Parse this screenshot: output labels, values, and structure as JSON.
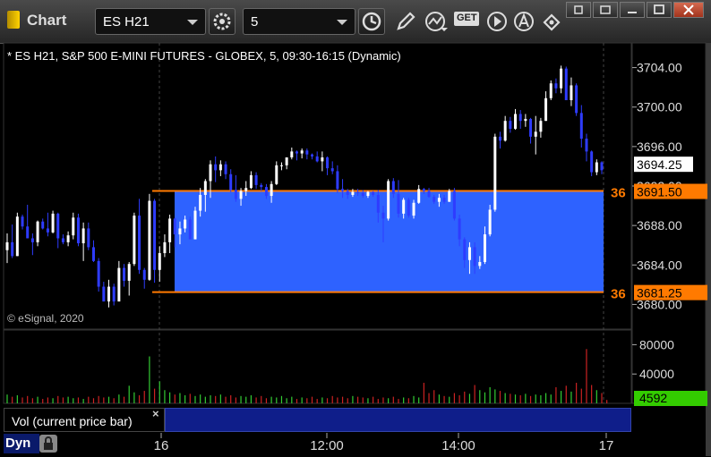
{
  "window": {
    "title": "Chart",
    "symbol_value": "ES H21",
    "interval_value": "5",
    "get_label": "GET"
  },
  "chart_header": "* ES H21, S&P 500 E-MINI FUTURES - GLOBEX, 5, 09:30-16:15 (Dynamic)",
  "copyright": "© eSignal, 2020",
  "volume_pane": {
    "label": "Vol (current price bar)",
    "close_symbol": "×"
  },
  "bottom": {
    "dyn_label": "Dyn"
  },
  "colors": {
    "up": "#ffffff",
    "down": "#2e3cff",
    "zone": "#2e62ff",
    "zone_line": "#ff7a00",
    "vol_up": "#33cc33",
    "vol_down": "#cc2222",
    "vol_badge": "#33cc00"
  },
  "chart_data": {
    "type": "candlestick",
    "title": "* ES H21, S&P 500 E-MINI FUTURES - GLOBEX, 5, 09:30-16:15 (Dynamic)",
    "x_ticks": [
      "16",
      "12:00",
      "14:00",
      "17"
    ],
    "y_ticks": [
      "3704.00",
      "3700.00",
      "3696.00",
      "3692.00",
      "3688.00",
      "3684.00",
      "3680.00"
    ],
    "ylim": [
      3677.5,
      3706.5
    ],
    "last_price": "3694.25",
    "last_price_value": 3694.25,
    "zone": {
      "top": 3691.5,
      "bottom": 3681.25,
      "top_label": "3691.50",
      "bottom_label": "3681.25",
      "left_tag": "36"
    },
    "candles": [
      [
        3685.5,
        3687.2,
        3684.2,
        3686.3
      ],
      [
        3686.3,
        3688.1,
        3684.7,
        3684.9
      ],
      [
        3684.9,
        3689.3,
        3684.9,
        3688.9
      ],
      [
        3688.9,
        3689.1,
        3687.6,
        3687.9
      ],
      [
        3687.9,
        3690.1,
        3686.7,
        3686.7
      ],
      [
        3686.7,
        3687.2,
        3685.0,
        3686.3
      ],
      [
        3686.3,
        3688.5,
        3685.9,
        3688.4
      ],
      [
        3688.4,
        3688.7,
        3687.6,
        3687.7
      ],
      [
        3687.7,
        3689.3,
        3686.9,
        3687.3
      ],
      [
        3687.3,
        3689.5,
        3687.2,
        3689.2
      ],
      [
        3689.2,
        3689.3,
        3685.7,
        3686.7
      ],
      [
        3686.7,
        3687.1,
        3686.1,
        3686.3
      ],
      [
        3686.3,
        3687.4,
        3685.9,
        3687.0
      ],
      [
        3687.0,
        3689.3,
        3686.6,
        3688.8
      ],
      [
        3688.8,
        3689.2,
        3685.9,
        3686.2
      ],
      [
        3686.2,
        3688.3,
        3684.4,
        3687.7
      ],
      [
        3687.7,
        3688.3,
        3685.5,
        3685.8
      ],
      [
        3685.8,
        3686.5,
        3684.3,
        3684.4
      ],
      [
        3684.4,
        3684.7,
        3681.3,
        3681.8
      ],
      [
        3681.8,
        3682.3,
        3680.3,
        3680.3
      ],
      [
        3680.3,
        3682.5,
        3679.7,
        3681.8
      ],
      [
        3681.8,
        3682.1,
        3679.9,
        3680.3
      ],
      [
        3680.3,
        3684.4,
        3680.3,
        3683.7
      ],
      [
        3683.7,
        3684.1,
        3681.8,
        3682.4
      ],
      [
        3682.4,
        3684.3,
        3680.9,
        3684.1
      ],
      [
        3684.1,
        3689.3,
        3683.9,
        3689.0
      ],
      [
        3689.0,
        3690.7,
        3683.1,
        3683.5
      ],
      [
        3683.5,
        3683.7,
        3681.6,
        3682.5
      ],
      [
        3682.5,
        3691.2,
        3682.4,
        3690.5
      ],
      [
        3690.5,
        3690.7,
        3682.2,
        3683.5
      ],
      [
        3683.5,
        3685.9,
        3682.3,
        3685.2
      ],
      [
        3685.2,
        3687.1,
        3684.8,
        3686.3
      ],
      [
        3686.3,
        3689.1,
        3685.2,
        3688.7
      ],
      [
        3688.7,
        3688.8,
        3685.8,
        3687.1
      ],
      [
        3687.1,
        3688.4,
        3686.1,
        3687.7
      ],
      [
        3687.7,
        3689.0,
        3687.3,
        3688.6
      ],
      [
        3688.6,
        3688.9,
        3686.6,
        3686.6
      ],
      [
        3686.6,
        3689.9,
        3686.6,
        3689.5
      ],
      [
        3689.5,
        3691.8,
        3688.9,
        3691.1
      ],
      [
        3691.1,
        3692.7,
        3689.4,
        3692.5
      ],
      [
        3692.5,
        3694.6,
        3690.8,
        3694.2
      ],
      [
        3694.2,
        3695.0,
        3692.4,
        3693.6
      ],
      [
        3693.6,
        3694.6,
        3693.0,
        3694.2
      ],
      [
        3694.2,
        3694.5,
        3692.7,
        3693.2
      ],
      [
        3693.2,
        3693.7,
        3691.4,
        3691.6
      ],
      [
        3691.6,
        3693.1,
        3690.4,
        3690.7
      ],
      [
        3690.7,
        3691.8,
        3690.0,
        3691.5
      ],
      [
        3691.5,
        3692.5,
        3691.0,
        3691.8
      ],
      [
        3691.8,
        3693.5,
        3691.7,
        3693.1
      ],
      [
        3693.1,
        3693.4,
        3691.7,
        3692.1
      ],
      [
        3692.1,
        3692.3,
        3691.5,
        3691.9
      ],
      [
        3691.9,
        3692.2,
        3690.7,
        3691.0
      ],
      [
        3691.0,
        3692.5,
        3690.3,
        3692.2
      ],
      [
        3692.2,
        3694.5,
        3692.1,
        3694.1
      ],
      [
        3694.1,
        3694.4,
        3693.6,
        3694.1
      ],
      [
        3694.1,
        3694.9,
        3693.7,
        3694.9
      ],
      [
        3694.9,
        3695.9,
        3694.7,
        3695.5
      ],
      [
        3695.5,
        3695.6,
        3694.6,
        3695.3
      ],
      [
        3695.3,
        3695.8,
        3694.8,
        3695.6
      ],
      [
        3695.6,
        3695.8,
        3694.7,
        3695.2
      ],
      [
        3695.2,
        3695.3,
        3694.7,
        3695.0
      ],
      [
        3695.0,
        3695.5,
        3694.4,
        3694.5
      ],
      [
        3694.5,
        3695.5,
        3693.5,
        3694.9
      ],
      [
        3694.9,
        3695.0,
        3693.1,
        3693.8
      ],
      [
        3693.8,
        3694.5,
        3693.2,
        3693.5
      ],
      [
        3693.5,
        3694.1,
        3691.3,
        3691.7
      ],
      [
        3691.7,
        3692.7,
        3690.8,
        3691.5
      ],
      [
        3691.5,
        3691.7,
        3690.7,
        3691.1
      ],
      [
        3691.1,
        3691.7,
        3690.9,
        3691.4
      ],
      [
        3691.4,
        3691.7,
        3691.0,
        3691.3
      ],
      [
        3691.3,
        3691.6,
        3690.8,
        3691.0
      ],
      [
        3691.0,
        3691.5,
        3690.8,
        3691.4
      ],
      [
        3691.4,
        3691.5,
        3690.9,
        3691.1
      ],
      [
        3691.1,
        3691.6,
        3688.3,
        3689.3
      ],
      [
        3689.3,
        3690.0,
        3686.3,
        3688.7
      ],
      [
        3688.7,
        3692.7,
        3688.5,
        3692.5
      ],
      [
        3692.5,
        3692.8,
        3690.8,
        3691.2
      ],
      [
        3691.2,
        3692.6,
        3688.8,
        3689.2
      ],
      [
        3689.2,
        3690.8,
        3688.7,
        3690.6
      ],
      [
        3690.6,
        3690.8,
        3688.8,
        3689.0
      ],
      [
        3689.0,
        3690.6,
        3688.7,
        3690.3
      ],
      [
        3690.3,
        3692.1,
        3690.2,
        3691.7
      ],
      [
        3691.7,
        3691.8,
        3691.2,
        3691.5
      ],
      [
        3691.5,
        3691.8,
        3690.8,
        3690.9
      ],
      [
        3690.9,
        3691.1,
        3690.2,
        3690.4
      ],
      [
        3690.4,
        3691.2,
        3689.9,
        3690.8
      ],
      [
        3690.8,
        3691.1,
        3690.2,
        3690.4
      ],
      [
        3690.4,
        3691.7,
        3690.4,
        3691.5
      ],
      [
        3691.5,
        3691.8,
        3688.5,
        3688.7
      ],
      [
        3688.7,
        3689.1,
        3685.9,
        3686.6
      ],
      [
        3686.6,
        3686.8,
        3683.7,
        3684.5
      ],
      [
        3684.5,
        3686.3,
        3683.1,
        3685.8
      ],
      [
        3685.8,
        3686.3,
        3683.1,
        3683.9
      ],
      [
        3683.9,
        3684.9,
        3683.6,
        3684.3
      ],
      [
        3684.3,
        3687.9,
        3684.1,
        3687.1
      ],
      [
        3687.1,
        3690.1,
        3686.9,
        3689.6
      ],
      [
        3689.6,
        3697.3,
        3689.4,
        3697.0
      ],
      [
        3697.0,
        3697.5,
        3695.8,
        3696.6
      ],
      [
        3696.6,
        3699.1,
        3696.5,
        3698.6
      ],
      [
        3698.6,
        3699.0,
        3697.4,
        3697.8
      ],
      [
        3697.8,
        3699.8,
        3697.7,
        3699.3
      ],
      [
        3699.3,
        3699.7,
        3697.8,
        3698.6
      ],
      [
        3698.6,
        3699.3,
        3698.0,
        3698.8
      ],
      [
        3698.8,
        3698.9,
        3696.3,
        3697.0
      ],
      [
        3697.0,
        3699.1,
        3695.2,
        3697.5
      ],
      [
        3697.5,
        3698.9,
        3696.9,
        3698.6
      ],
      [
        3698.6,
        3701.6,
        3698.6,
        3700.9
      ],
      [
        3700.9,
        3702.7,
        3700.7,
        3702.4
      ],
      [
        3702.4,
        3702.9,
        3701.4,
        3701.9
      ],
      [
        3701.9,
        3704.2,
        3701.4,
        3703.9
      ],
      [
        3703.9,
        3704.1,
        3700.7,
        3700.7
      ],
      [
        3700.7,
        3703.0,
        3700.1,
        3702.2
      ],
      [
        3702.2,
        3702.4,
        3699.1,
        3699.4
      ],
      [
        3699.4,
        3700.2,
        3695.9,
        3696.8
      ],
      [
        3696.8,
        3697.3,
        3694.5,
        3695.5
      ],
      [
        3695.5,
        3695.6,
        3693.0,
        3693.4
      ],
      [
        3693.4,
        3694.7,
        3693.1,
        3694.4
      ],
      [
        3694.4,
        3694.5,
        3693.2,
        3693.6
      ]
    ],
    "volume": {
      "ylim": [
        0,
        100000
      ],
      "y_ticks": [
        "80000",
        "40000"
      ],
      "last_label": "4592",
      "values": [
        12000,
        9000,
        11000,
        8000,
        10000,
        7000,
        9000,
        6000,
        8000,
        7000,
        10000,
        8000,
        9000,
        7000,
        8000,
        6000,
        9000,
        7000,
        10000,
        8000,
        9000,
        7000,
        12000,
        9000,
        24000,
        15000,
        11000,
        17000,
        64000,
        20000,
        30000,
        18000,
        15000,
        12000,
        14000,
        11000,
        13000,
        10000,
        12000,
        9000,
        11000,
        10000,
        12000,
        9000,
        11000,
        8000,
        10000,
        9000,
        11000,
        8000,
        10000,
        7000,
        9000,
        8000,
        10000,
        7000,
        9000,
        6000,
        8000,
        7000,
        9000,
        6000,
        8000,
        7000,
        10000,
        8000,
        9000,
        7000,
        10000,
        9000,
        8000,
        7000,
        9000,
        6000,
        8000,
        7000,
        9000,
        6000,
        8000,
        7000,
        10000,
        8000,
        28000,
        14000,
        18000,
        12000,
        10000,
        9000,
        14000,
        11000,
        16000,
        13000,
        25000,
        18000,
        15000,
        22000,
        19000,
        17000,
        14000,
        13000,
        12000,
        11000,
        13000,
        10000,
        12000,
        11000,
        14000,
        12000,
        22000,
        17000,
        24000,
        16000,
        28000,
        20000,
        74000,
        25000,
        18000,
        14000,
        4592
      ],
      "directions": "derived from candles"
    }
  }
}
